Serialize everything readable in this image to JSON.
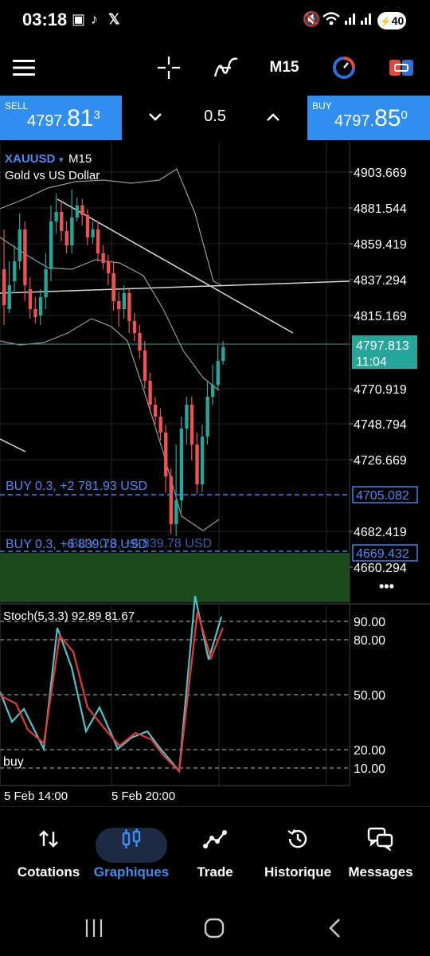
{
  "status": {
    "time": "03:18",
    "battery": "40"
  },
  "toolbar": {
    "timeframe": "M15"
  },
  "trade": {
    "sell_label": "SELL",
    "sell_small": "4797.",
    "sell_big": "81",
    "sell_sup": "3",
    "buy_label": "BUY",
    "buy_small": "4797.",
    "buy_big": "85",
    "buy_sup": "0",
    "volume": "0.5"
  },
  "chart": {
    "symbol": "XAUUSD",
    "symbol_arrow": "▾",
    "timeframe": "M15",
    "description": "Gold vs US Dollar",
    "price_labels": [
      "4903.669",
      "4881.544",
      "4859.419",
      "4837.294",
      "4815.169",
      "4770.919",
      "4748.794",
      "4726.669",
      "4682.419",
      "4660.294"
    ],
    "current_price": "4797.813",
    "countdown": "11:04",
    "position_1": {
      "text": "BUY 0.3,  +2 781.93 USD",
      "price": "4705.082"
    },
    "position_2": {
      "text": "BUY 0.3,  +6 839.78 USD",
      "price": "4669.432"
    },
    "stoch_label": "Stoch(5,3,3) 92.89 81.67",
    "stoch_levels": [
      "90.00",
      "80.00",
      "50.00",
      "20.00",
      "10.00"
    ],
    "buy_annotation": "buy",
    "time_labels": [
      "5 Feb 14:00",
      "5 Feb 20:00"
    ],
    "more": "•••",
    "colors": {
      "bull": "#26a69a",
      "bear": "#ef5350",
      "position_line": "#3a82f7",
      "current_price_bg": "#26a69a",
      "stoch_k": "#4fc3c7",
      "stoch_d": "#e53935"
    }
  },
  "nav": [
    {
      "label": "Cotations",
      "icon": "sort-arrows-icon"
    },
    {
      "label": "Graphiques",
      "icon": "candlestick-icon"
    },
    {
      "label": "Trade",
      "icon": "trade-line-icon"
    },
    {
      "label": "Historique",
      "icon": "history-icon"
    },
    {
      "label": "Messages",
      "icon": "messages-icon"
    }
  ]
}
